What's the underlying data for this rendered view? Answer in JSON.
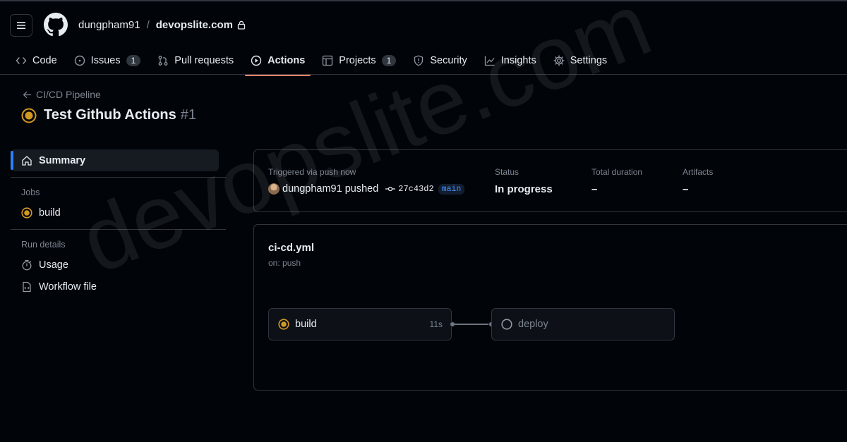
{
  "repo": {
    "owner": "dungpham91",
    "separator": "/",
    "name": "devopslite.com",
    "lock_icon": "lock-icon",
    "logo_icon": "github-logo-icon",
    "menu_icon": "hamburger-icon"
  },
  "tabs": [
    {
      "label": "Code",
      "icon": "code-icon"
    },
    {
      "label": "Issues",
      "icon": "issue-icon",
      "count": "1"
    },
    {
      "label": "Pull requests",
      "icon": "pull-request-icon"
    },
    {
      "label": "Actions",
      "icon": "play-icon",
      "active": true
    },
    {
      "label": "Projects",
      "icon": "table-icon",
      "count": "1"
    },
    {
      "label": "Security",
      "icon": "shield-icon"
    },
    {
      "label": "Insights",
      "icon": "graph-icon"
    },
    {
      "label": "Settings",
      "icon": "gear-icon"
    }
  ],
  "run": {
    "back_label": "CI/CD Pipeline",
    "title": "Test Github Actions",
    "number": "#1"
  },
  "sidebar": {
    "summary_label": "Summary",
    "jobs_heading": "Jobs",
    "jobs": [
      {
        "label": "build"
      }
    ],
    "run_details_heading": "Run details",
    "details": [
      {
        "label": "Usage"
      },
      {
        "label": "Workflow file"
      }
    ]
  },
  "summary": {
    "trigger_label": "Triggered via push now",
    "actor": "dungpham91",
    "action": "pushed",
    "sha": "27c43d2",
    "branch": "main",
    "status_label": "Status",
    "status_value": "In progress",
    "duration_label": "Total duration",
    "duration_value": "–",
    "artifacts_label": "Artifacts",
    "artifacts_value": "–"
  },
  "workflow": {
    "file": "ci-cd.yml",
    "trigger": "on: push",
    "jobs": [
      {
        "name": "build",
        "time": "11s",
        "state": "in-progress"
      },
      {
        "name": "deploy",
        "state": "pending"
      }
    ]
  },
  "colors": {
    "accent_tab": "#f78166",
    "in_progress": "#d29922",
    "selected_bar": "#2f81f7"
  },
  "watermark": "devopslite.com"
}
